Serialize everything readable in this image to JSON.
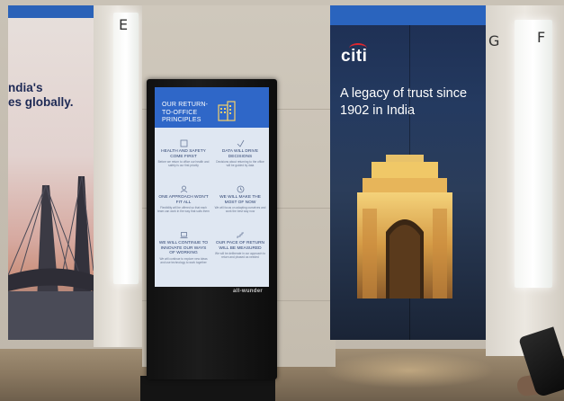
{
  "pillar_letters": {
    "left": "E",
    "middle": "G",
    "right": "F"
  },
  "left_banner": {
    "text": "ndia's\nes globally."
  },
  "right_banner": {
    "logo": "citi",
    "tagline": "A legacy of trust since 1902 in India"
  },
  "kiosk": {
    "screen_title": "OUR RETURN-TO-OFFICE PRINCIPLES",
    "brand": "all-wunder",
    "principles": [
      {
        "title": "HEALTH AND SAFETY COME FIRST",
        "body": "Before we return to office our health and safety is our first priority"
      },
      {
        "title": "DATA WILL DRIVE DECISIONS",
        "body": "Decisions about returning to the office will be guided by data"
      },
      {
        "title": "ONE APPROACH WON'T FIT ALL",
        "body": "Flexibility will be offered so that each team can work in the way that suits them"
      },
      {
        "title": "WE WILL MAKE THE MOST OF NOW",
        "body": "We will focus on adapting ourselves and work the best way now"
      },
      {
        "title": "WE WILL CONTINUE TO INNOVATE OUR WAYS OF WORKING",
        "body": "We will continue to explore new ideas and use technology to work together"
      },
      {
        "title": "OUR PACE OF RETURN WILL BE MEASURED",
        "body": "We will be deliberate in our approach to return and phased as needed"
      }
    ]
  }
}
